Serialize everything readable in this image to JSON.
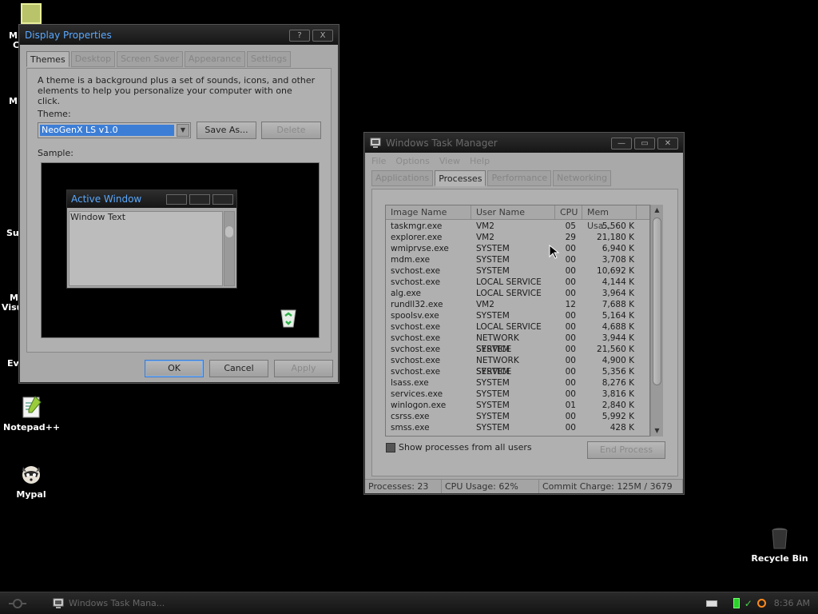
{
  "desktop": {
    "icons": [
      {
        "label": "Notepad++"
      },
      {
        "label": "Mypal"
      },
      {
        "label": "Recycle Bin"
      }
    ],
    "cut_labels": [
      "M",
      "C",
      "M",
      "Su",
      "M",
      "Visu",
      "Ev"
    ]
  },
  "display_properties": {
    "title": "Display Properties",
    "help_btn": "?",
    "close_btn": "X",
    "tabs": [
      "Themes",
      "Desktop",
      "Screen Saver",
      "Appearance",
      "Settings"
    ],
    "description": "A theme is a background plus a set of sounds, icons, and other elements to help you personalize your computer with one click.",
    "theme_label": "Theme:",
    "theme_value": "NeoGenX LS v1.0",
    "save_as": "Save As...",
    "delete": "Delete",
    "sample_label": "Sample:",
    "preview": {
      "window_title": "Active Window",
      "window_text": "Window Text"
    },
    "ok": "OK",
    "cancel": "Cancel",
    "apply": "Apply"
  },
  "task_manager": {
    "title": "Windows Task Manager",
    "menu": [
      "File",
      "Options",
      "View",
      "Help"
    ],
    "tabs": [
      "Applications",
      "Processes",
      "Performance",
      "Networking"
    ],
    "columns": [
      "Image Name",
      "User Name",
      "CPU",
      "Mem Usa..."
    ],
    "rows": [
      [
        "taskmgr.exe",
        "VM2",
        "05",
        "5,560 K"
      ],
      [
        "explorer.exe",
        "VM2",
        "29",
        "21,180 K"
      ],
      [
        "wmiprvse.exe",
        "SYSTEM",
        "00",
        "6,940 K"
      ],
      [
        "mdm.exe",
        "SYSTEM",
        "00",
        "3,708 K"
      ],
      [
        "svchost.exe",
        "SYSTEM",
        "00",
        "10,692 K"
      ],
      [
        "svchost.exe",
        "LOCAL SERVICE",
        "00",
        "4,144 K"
      ],
      [
        "alg.exe",
        "LOCAL SERVICE",
        "00",
        "3,964 K"
      ],
      [
        "rundll32.exe",
        "VM2",
        "12",
        "7,688 K"
      ],
      [
        "spoolsv.exe",
        "SYSTEM",
        "00",
        "5,164 K"
      ],
      [
        "svchost.exe",
        "LOCAL SERVICE",
        "00",
        "4,688 K"
      ],
      [
        "svchost.exe",
        "NETWORK SERVICE",
        "00",
        "3,944 K"
      ],
      [
        "svchost.exe",
        "SYSTEM",
        "00",
        "21,560 K"
      ],
      [
        "svchost.exe",
        "NETWORK SERVICE",
        "00",
        "4,900 K"
      ],
      [
        "svchost.exe",
        "SYSTEM",
        "00",
        "5,356 K"
      ],
      [
        "lsass.exe",
        "SYSTEM",
        "00",
        "8,276 K"
      ],
      [
        "services.exe",
        "SYSTEM",
        "00",
        "3,816 K"
      ],
      [
        "winlogon.exe",
        "SYSTEM",
        "01",
        "2,840 K"
      ],
      [
        "csrss.exe",
        "SYSTEM",
        "00",
        "5,992 K"
      ],
      [
        "smss.exe",
        "SYSTEM",
        "00",
        "428 K"
      ]
    ],
    "show_all_label": "Show processes from all users",
    "end_process": "End Process",
    "status": {
      "processes": "Processes: 23",
      "cpu": "CPU Usage: 62%",
      "commit": "Commit Charge: 125M / 3679"
    }
  },
  "taskbar": {
    "task_button": "Windows Task Mana...",
    "clock": "8:36 AM"
  }
}
